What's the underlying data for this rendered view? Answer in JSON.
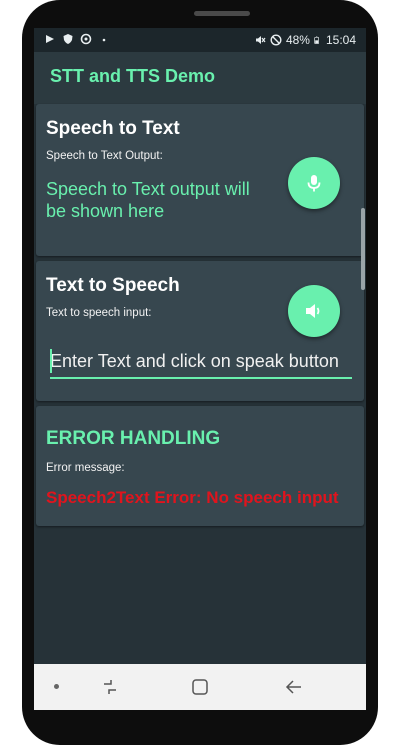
{
  "status_bar": {
    "battery": "48%",
    "time": "15:04",
    "left_icons": [
      "play-icon",
      "shield-icon",
      "sync-icon",
      "dot-icon"
    ],
    "right_icons": [
      "mute-icon",
      "do-not-disturb-icon",
      "battery-icon"
    ]
  },
  "app": {
    "title": "STT and TTS Demo",
    "accent_color": "#69f0ae"
  },
  "stt_card": {
    "title": "Speech to Text",
    "label": "Speech to Text Output:",
    "output": "Speech to Text output will be shown here",
    "button_icon": "microphone-icon"
  },
  "tts_card": {
    "title": "Text to Speech",
    "label": "Text to speech input:",
    "input_value": "",
    "input_placeholder": "Enter Text and click on speak button",
    "button_icon": "speaker-icon"
  },
  "error_card": {
    "title": "ERROR HANDLING",
    "label": "Error message:",
    "message": "Speech2Text Error: No speech input",
    "error_color": "#e0141d"
  },
  "nav_bar": {
    "icons": [
      "dot-icon",
      "recent-apps-icon",
      "home-icon",
      "back-icon"
    ]
  }
}
